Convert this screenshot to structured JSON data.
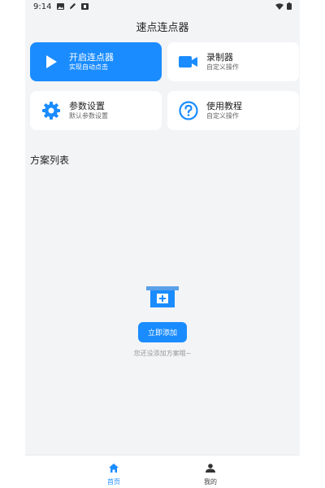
{
  "status_bar": {
    "time": "9:14"
  },
  "header": {
    "title": "速点连点器"
  },
  "cards": [
    {
      "title": "开启连点器",
      "subtitle": "实现自动点击",
      "icon": "play-icon"
    },
    {
      "title": "录制器",
      "subtitle": "自定义操作",
      "icon": "video-camera-icon"
    },
    {
      "title": "参数设置",
      "subtitle": "默认参数设置",
      "icon": "gear-icon"
    },
    {
      "title": "使用教程",
      "subtitle": "自定义操作",
      "icon": "question-icon"
    }
  ],
  "list": {
    "title": "方案列表"
  },
  "empty_state": {
    "button_label": "立即添加",
    "message": "您还没添加方案哦~"
  },
  "bottom_nav": [
    {
      "label": "首页",
      "icon": "home-icon",
      "active": true
    },
    {
      "label": "我的",
      "icon": "user-icon",
      "active": false
    }
  ],
  "colors": {
    "accent": "#1a8cff",
    "background": "#f3f4f6",
    "card": "#ffffff"
  }
}
